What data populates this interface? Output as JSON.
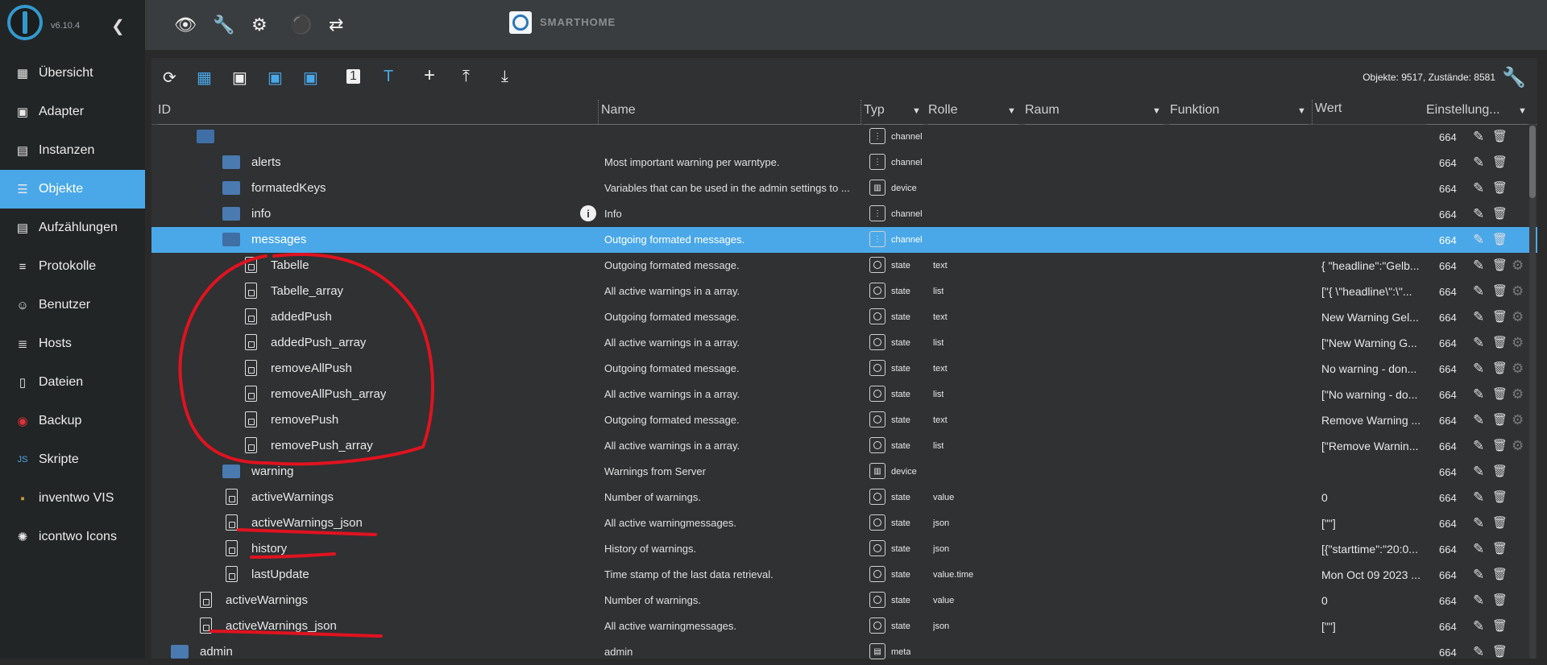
{
  "app": {
    "version": "v6.10.4",
    "brand": "SMARTHOME"
  },
  "sidebar": {
    "items": [
      {
        "label": "Übersicht",
        "icon": "grid-icon"
      },
      {
        "label": "Adapter",
        "icon": "store-icon"
      },
      {
        "label": "Instanzen",
        "icon": "instances-icon"
      },
      {
        "label": "Objekte",
        "icon": "list-icon",
        "active": true
      },
      {
        "label": "Aufzählungen",
        "icon": "enum-icon"
      },
      {
        "label": "Protokolle",
        "icon": "log-icon"
      },
      {
        "label": "Benutzer",
        "icon": "user-icon"
      },
      {
        "label": "Hosts",
        "icon": "hosts-icon"
      },
      {
        "label": "Dateien",
        "icon": "file-icon"
      },
      {
        "label": "Backup",
        "icon": "backup-icon"
      },
      {
        "label": "Skripte",
        "icon": "js-icon"
      },
      {
        "label": "inventwo VIS",
        "icon": "inventwo-icon"
      },
      {
        "label": "icontwo Icons",
        "icon": "icontwo-icon"
      }
    ]
  },
  "toolbar": {
    "counts": "Objekte: 9517, Zustände: 8581"
  },
  "columns": {
    "id": "ID",
    "name": "Name",
    "type": "Typ",
    "role": "Rolle",
    "room": "Raum",
    "function": "Funktion",
    "value": "Wert",
    "settings": "Einstellung..."
  },
  "rows": [
    {
      "id": "",
      "name": "",
      "type": "channel",
      "role": "",
      "value": "",
      "acl": "664",
      "indent": 0,
      "icon": "folder-open"
    },
    {
      "id": "alerts",
      "name": "Most important warning per warntype.",
      "type": "channel",
      "role": "",
      "value": "",
      "acl": "664",
      "indent": 1,
      "icon": "folder"
    },
    {
      "id": "formatedKeys",
      "name": "Variables that can be used in the admin settings to ...",
      "type": "device",
      "role": "",
      "value": "",
      "acl": "664",
      "indent": 1,
      "icon": "folder"
    },
    {
      "id": "info",
      "name": "Info",
      "type": "channel",
      "role": "",
      "value": "",
      "acl": "664",
      "indent": 1,
      "icon": "folder"
    },
    {
      "id": "messages",
      "name": "Outgoing formated messages.",
      "type": "channel",
      "role": "",
      "value": "",
      "acl": "664",
      "indent": 1,
      "icon": "folder-open",
      "selected": true
    },
    {
      "id": "Tabelle",
      "name": "Outgoing formated message.",
      "type": "state",
      "role": "text",
      "value": "{ \"headline\":\"Gelb...",
      "acl": "664",
      "indent": 2,
      "icon": "file"
    },
    {
      "id": "Tabelle_array",
      "name": "All active warnings in a array.",
      "type": "state",
      "role": "list",
      "value": "[\"{ \\\"headline\\\":\\\"...",
      "acl": "664",
      "indent": 2,
      "icon": "file"
    },
    {
      "id": "addedPush",
      "name": "Outgoing formated message.",
      "type": "state",
      "role": "text",
      "value": "New Warning Gel...",
      "acl": "664",
      "indent": 2,
      "icon": "file"
    },
    {
      "id": "addedPush_array",
      "name": "All active warnings in a array.",
      "type": "state",
      "role": "list",
      "value": "[\"New Warning G...",
      "acl": "664",
      "indent": 2,
      "icon": "file"
    },
    {
      "id": "removeAllPush",
      "name": "Outgoing formated message.",
      "type": "state",
      "role": "text",
      "value": "No warning - don...",
      "acl": "664",
      "indent": 2,
      "icon": "file"
    },
    {
      "id": "removeAllPush_array",
      "name": "All active warnings in a array.",
      "type": "state",
      "role": "list",
      "value": "[\"No warning - do...",
      "acl": "664",
      "indent": 2,
      "icon": "file"
    },
    {
      "id": "removePush",
      "name": "Outgoing formated message.",
      "type": "state",
      "role": "text",
      "value": "Remove Warning ...",
      "acl": "664",
      "indent": 2,
      "icon": "file"
    },
    {
      "id": "removePush_array",
      "name": "All active warnings in a array.",
      "type": "state",
      "role": "list",
      "value": "[\"Remove Warnin...",
      "acl": "664",
      "indent": 2,
      "icon": "file"
    },
    {
      "id": "warning",
      "name": "Warnings from Server",
      "type": "device",
      "role": "",
      "value": "",
      "acl": "664",
      "indent": 1,
      "icon": "folder"
    },
    {
      "id": "activeWarnings",
      "name": "Number of warnings.",
      "type": "state",
      "role": "value",
      "value": "0",
      "acl": "664",
      "indent": 1,
      "icon": "file"
    },
    {
      "id": "activeWarnings_json",
      "name": "All active warningmessages.",
      "type": "state",
      "role": "json",
      "value": "[\"\"]",
      "acl": "664",
      "indent": 1,
      "icon": "file"
    },
    {
      "id": "history",
      "name": "History of warnings.",
      "type": "state",
      "role": "json",
      "value": "[{\"starttime\":\"20:0...",
      "acl": "664",
      "indent": 1,
      "icon": "file"
    },
    {
      "id": "lastUpdate",
      "name": "Time stamp of the last data retrieval.",
      "type": "state",
      "role": "value.time",
      "value": "Mon Oct 09 2023 ...",
      "acl": "664",
      "indent": 1,
      "icon": "file"
    },
    {
      "id": "activeWarnings",
      "name": "Number of warnings.",
      "type": "state",
      "role": "value",
      "value": "0",
      "acl": "664",
      "indent": 0,
      "icon": "file"
    },
    {
      "id": "activeWarnings_json",
      "name": "All active warningmessages.",
      "type": "state",
      "role": "json",
      "value": "[\"\"]",
      "acl": "664",
      "indent": 0,
      "icon": "file"
    },
    {
      "id": "admin",
      "name": "admin",
      "type": "meta",
      "role": "",
      "value": "",
      "acl": "664",
      "indent": -1,
      "icon": "folder"
    }
  ]
}
